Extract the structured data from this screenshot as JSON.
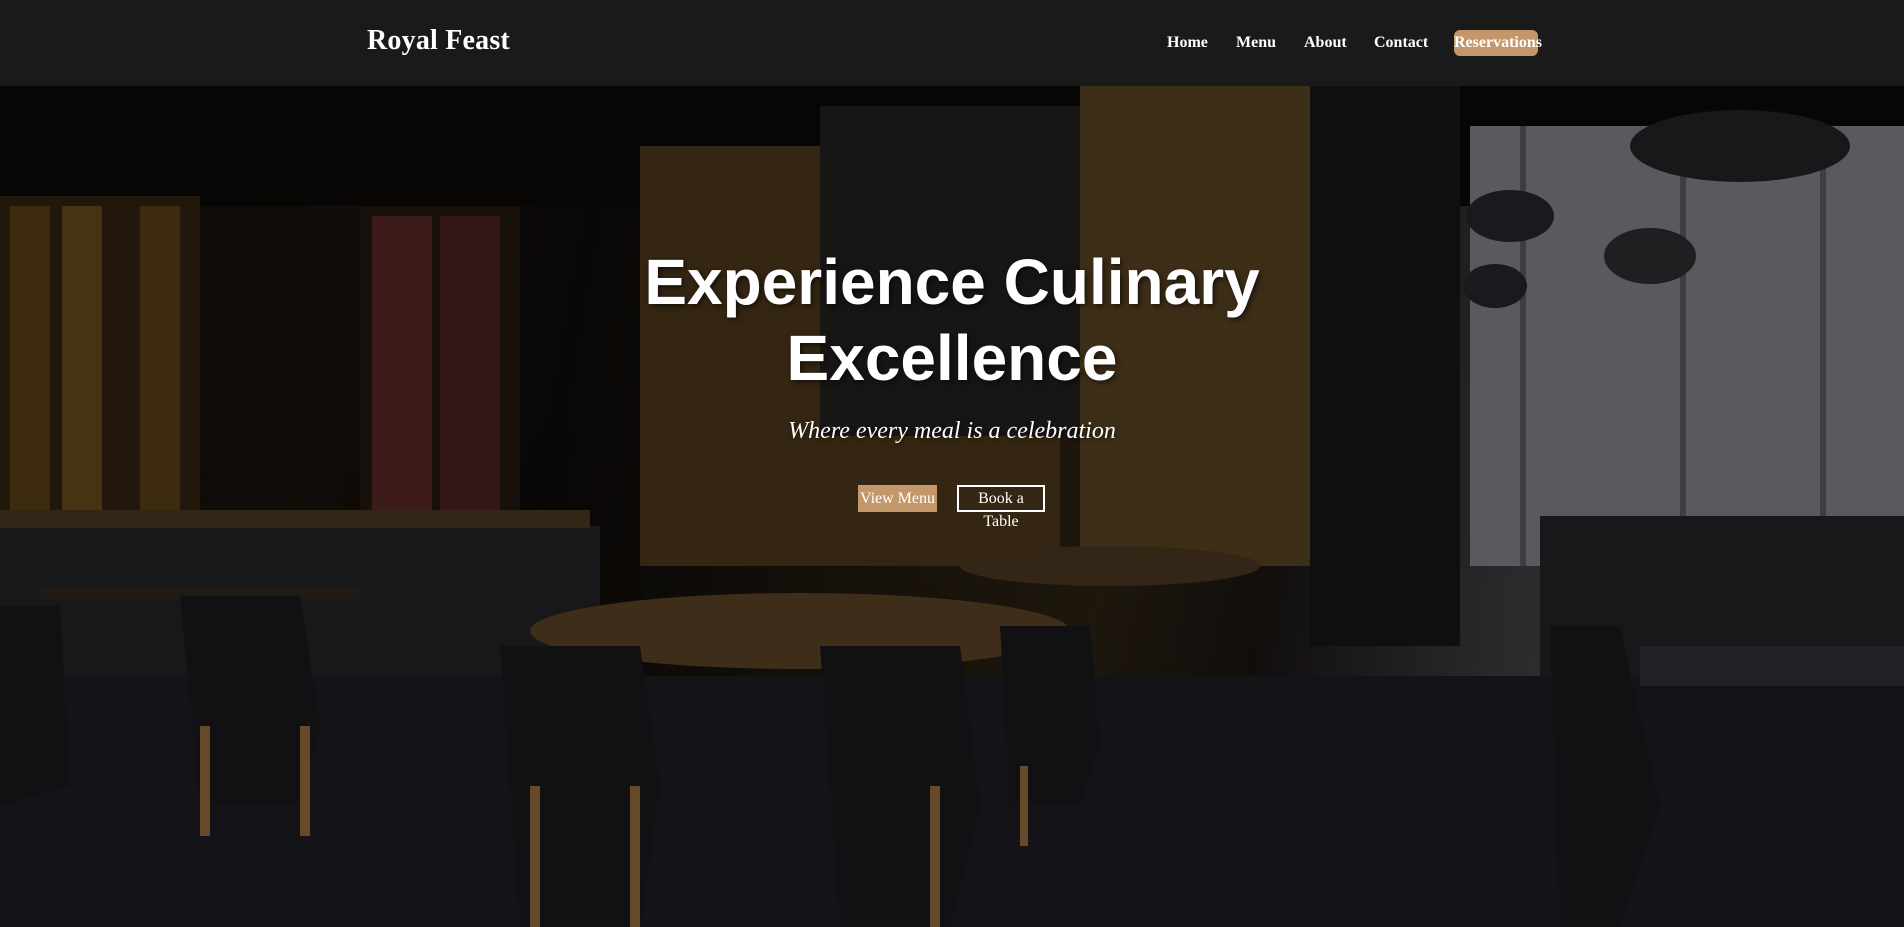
{
  "brand": {
    "name": "Royal Feast"
  },
  "nav": {
    "items": [
      "Home",
      "Menu",
      "About",
      "Contact"
    ],
    "cta": "Reservations"
  },
  "hero": {
    "title": "Experience Culinary Excellence",
    "subtitle": "Where every meal is a celebration",
    "primary_button": "View Menu",
    "secondary_button": "Book a Table",
    "background_image": "restaurant-interior-photo"
  },
  "colors": {
    "header_bg": "#1a1a1a",
    "accent": "#c4976a",
    "text": "#ffffff"
  }
}
